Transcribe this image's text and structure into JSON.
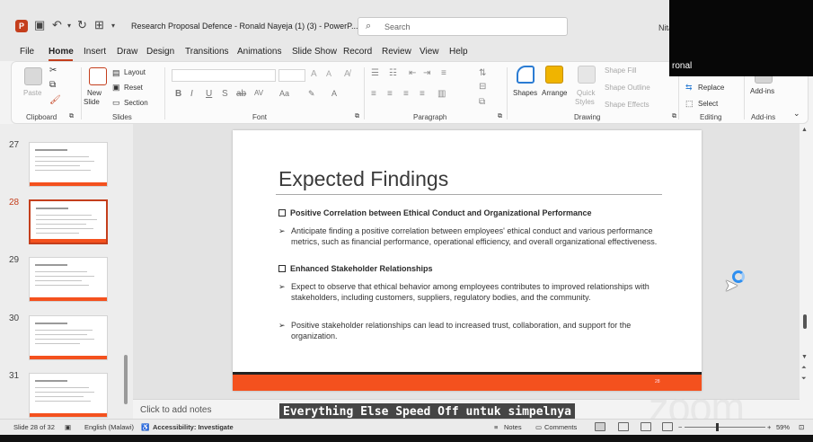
{
  "window": {
    "app_icon_letter": "P",
    "title": "Research Proposal Defence - Ronald Nayeja (1) (3)  -  PowerP...",
    "search_placeholder": "Search",
    "user": "Nita"
  },
  "tabs": [
    "File",
    "Home",
    "Insert",
    "Draw",
    "Design",
    "Transitions",
    "Animations",
    "Slide Show",
    "Record",
    "Review",
    "View",
    "Help"
  ],
  "active_tab": "Home",
  "ribbon": {
    "clipboard": {
      "label": "Clipboard",
      "paste": "Paste"
    },
    "slides": {
      "label": "Slides",
      "new_slide": "New",
      "new_slide2": "Slide",
      "layout": "Layout",
      "reset": "Reset",
      "section": "Section"
    },
    "font": {
      "label": "Font"
    },
    "paragraph": {
      "label": "Paragraph"
    },
    "drawing": {
      "label": "Drawing",
      "shapes": "Shapes",
      "arrange": "Arrange",
      "quick_styles": "Quick",
      "quick_styles2": "Styles",
      "shape_fill": "Shape Fill",
      "shape_outline": "Shape Outline",
      "shape_effects": "Shape Effects"
    },
    "editing": {
      "label": "Editing",
      "replace": "Replace",
      "select": "Select"
    },
    "addins": {
      "label": "Add-ins",
      "addins_btn": "Add-ins"
    }
  },
  "selfcam": {
    "name": "ronal"
  },
  "thumbnails": [
    {
      "num": "27",
      "selected": false
    },
    {
      "num": "28",
      "selected": true
    },
    {
      "num": "29",
      "selected": false
    },
    {
      "num": "30",
      "selected": false
    },
    {
      "num": "31",
      "selected": false
    }
  ],
  "slide": {
    "title": "Expected Findings",
    "section1_heading": "Positive Correlation between Ethical Conduct and Organizational Performance",
    "section1_bullet1": "Anticipate finding a positive correlation between employees' ethical conduct and various performance metrics, such as financial performance, operational efficiency, and overall organizational effectiveness.",
    "section2_heading": "Enhanced Stakeholder Relationships",
    "section2_bullet1": "Expect to observe that ethical behavior among employees contributes to improved relationships with stakeholders, including customers, suppliers, regulatory bodies, and the community.",
    "section2_bullet2": "Positive stakeholder relationships can lead to increased trust, collaboration, and support for the organization.",
    "footer_page": "28"
  },
  "notes_placeholder": "Click to add notes",
  "caption": "Everything Else Speed Off untuk simpelnya",
  "zoom_watermark": "zoom",
  "status": {
    "slide_of": "Slide 28 of 32",
    "language": "English (Malawi)",
    "accessibility": "Accessibility: Investigate",
    "notes": "Notes",
    "comments": "Comments",
    "zoom_level": "59%"
  }
}
